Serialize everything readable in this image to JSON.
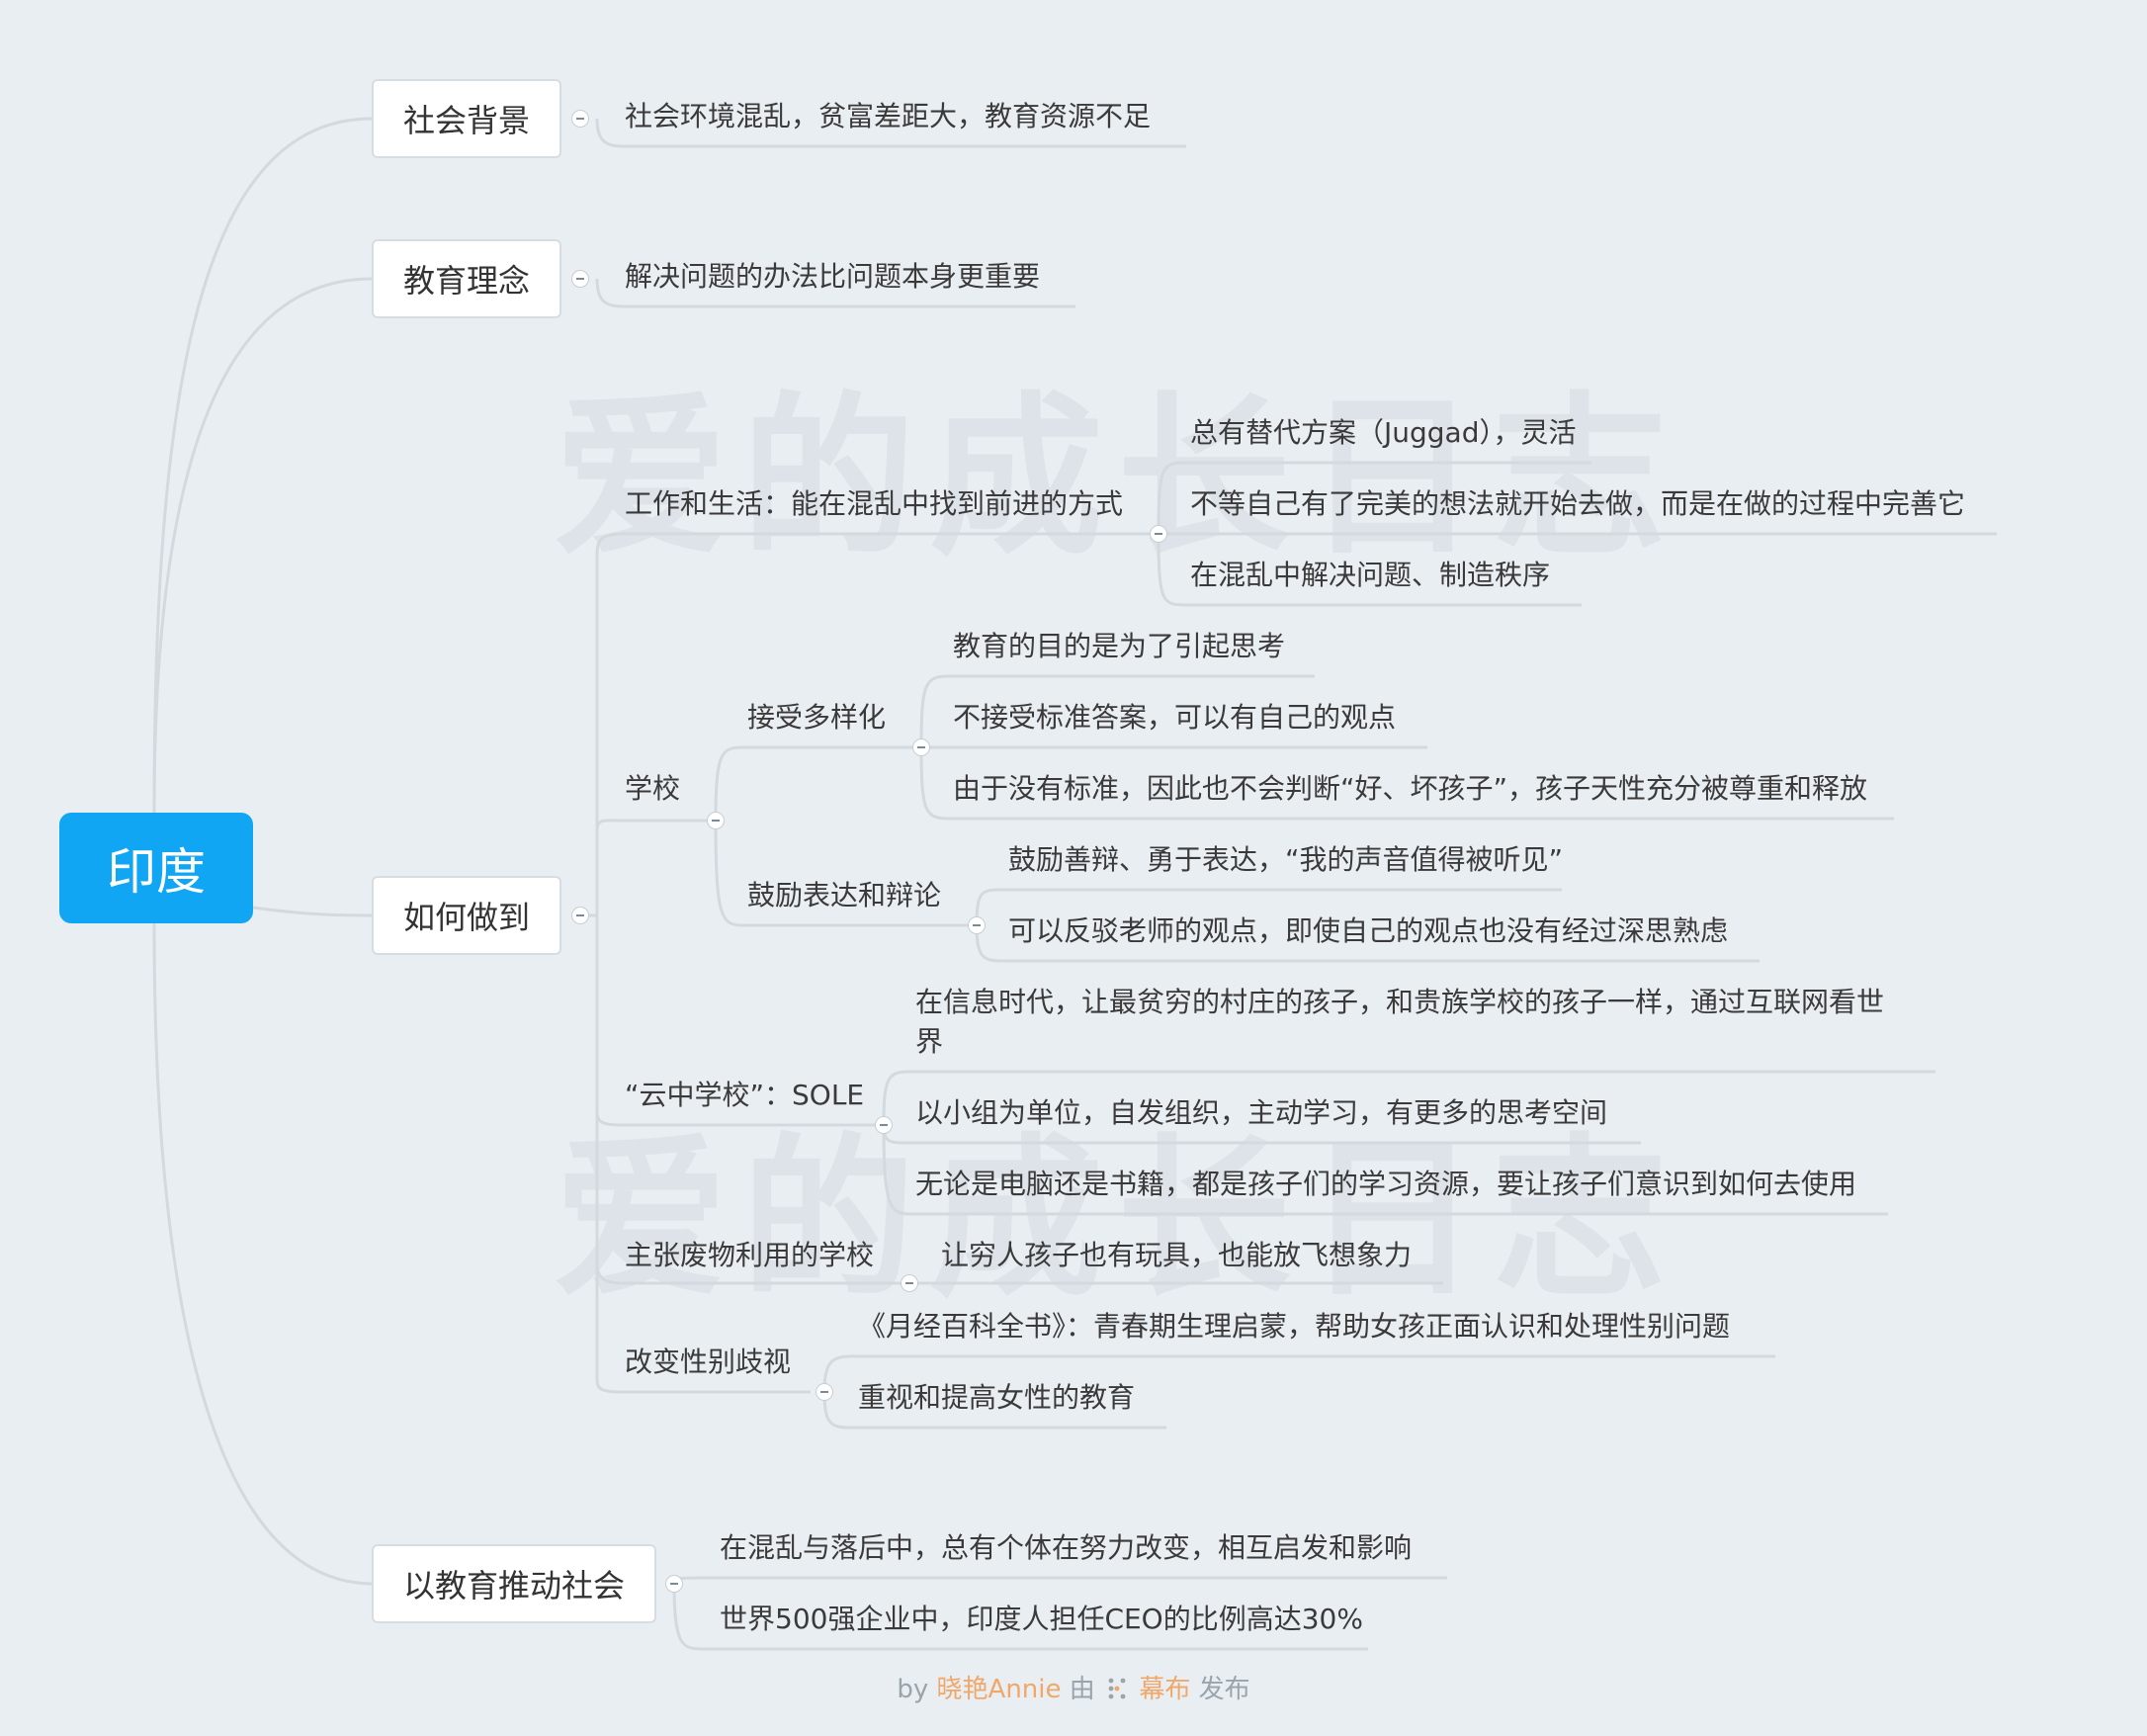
{
  "root": {
    "label": "印度"
  },
  "watermark": "爱的成长日志",
  "branches": {
    "b1": {
      "label": "社会背景",
      "children": [
        "社会环境混乱，贫富差距大，教育资源不足"
      ]
    },
    "b2": {
      "label": "教育理念",
      "children": [
        "解决问题的办法比问题本身更重要"
      ]
    },
    "b3": {
      "label": "如何做到",
      "work": {
        "label": "工作和生活：能在混乱中找到前进的方式",
        "children": [
          "总有替代方案（Juggad），灵活",
          "不等自己有了完美的想法就开始去做，而是在做的过程中完善它",
          "在混乱中解决问题、制造秩序"
        ]
      },
      "school": {
        "label": "学校",
        "diverse": {
          "label": "接受多样化",
          "children": [
            "教育的目的是为了引起思考",
            "不接受标准答案，可以有自己的观点",
            "由于没有标准，因此也不会判断“好、坏孩子”，孩子天性充分被尊重和释放"
          ]
        },
        "debate": {
          "label": "鼓励表达和辩论",
          "children": [
            "鼓励善辩、勇于表达，“我的声音值得被听见”",
            "可以反驳老师的观点，即使自己的观点也没有经过深思熟虑"
          ]
        }
      },
      "cloud": {
        "label": "“云中学校”：SOLE",
        "children": [
          "在信息时代，让最贫穷的村庄的孩子，和贵族学校的孩子一样，通过互联网看世界",
          "以小组为单位，自发组织，主动学习，有更多的思考空间",
          "无论是电脑还是书籍，都是孩子们的学习资源，要让孩子们意识到如何去使用"
        ]
      },
      "recycle": {
        "label": "主张废物利用的学校",
        "children": [
          "让穷人孩子也有玩具，也能放飞想象力"
        ]
      },
      "gender": {
        "label": "改变性别歧视",
        "children": [
          "《月经百科全书》：青春期生理启蒙，帮助女孩正面认识和处理性别问题",
          "重视和提高女性的教育"
        ]
      }
    },
    "b4": {
      "label": "以教育推动社会",
      "children": [
        "在混乱与落后中，总有个体在努力改变，相互启发和影响",
        "世界500强企业中，印度人担任CEO的比例高达30%"
      ]
    }
  },
  "footer": {
    "by": "by",
    "author": "晓艳Annie",
    "mid": "由",
    "brand": "幕布",
    "end": "发布"
  },
  "colors": {
    "root": "#11a6f3",
    "line": "#d3d9de",
    "background": "#e9eef2",
    "accent": "#f0a86a"
  }
}
